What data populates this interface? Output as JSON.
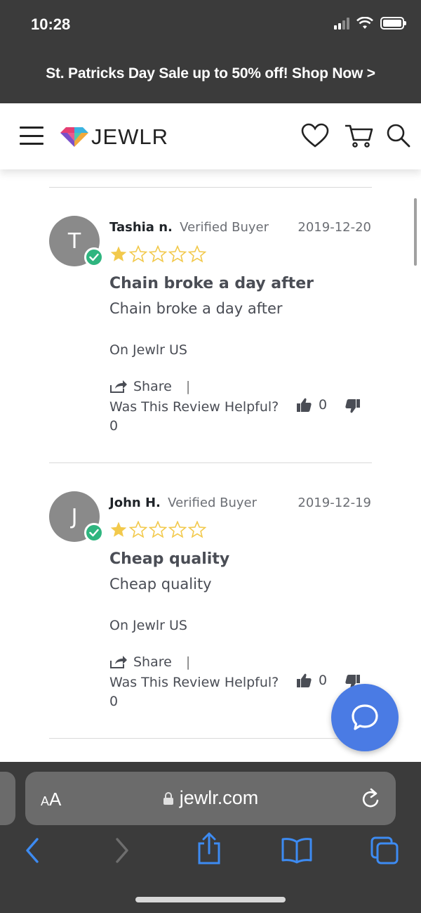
{
  "status_bar": {
    "time": "10:28"
  },
  "promo_banner": {
    "text": "St. Patricks Day Sale up to 50% off! Shop Now >"
  },
  "header": {
    "logo_text": "JEWLR"
  },
  "reviews": [
    {
      "initial": "T",
      "name": "Tashia n.",
      "verified": "Verified Buyer",
      "date": "2019-12-20",
      "rating": 1,
      "max_rating": 5,
      "title": "Chain broke a day after",
      "body": "Chain broke a day after",
      "source": "On Jewlr US",
      "share_label": "Share",
      "helpful_label": "Was This Review Helpful?",
      "up_votes": "0",
      "down_votes": "0"
    },
    {
      "initial": "J",
      "name": "John H.",
      "verified": "Verified Buyer",
      "date": "2019-12-19",
      "rating": 1,
      "max_rating": 5,
      "title": "Cheap quality",
      "body": "Cheap quality",
      "source": "On Jewlr US",
      "share_label": "Share",
      "helpful_label": "Was This Review Helpful?",
      "up_votes": "0",
      "down_votes": "0"
    }
  ],
  "browser": {
    "aa_small": "A",
    "aa_big": "A",
    "url": "jewlr.com"
  },
  "colors": {
    "star_filled": "#f2c94c",
    "verified_check": "#2fb57f",
    "chat_button": "#4a7be4",
    "ios_blue": "#3d8bf2"
  }
}
